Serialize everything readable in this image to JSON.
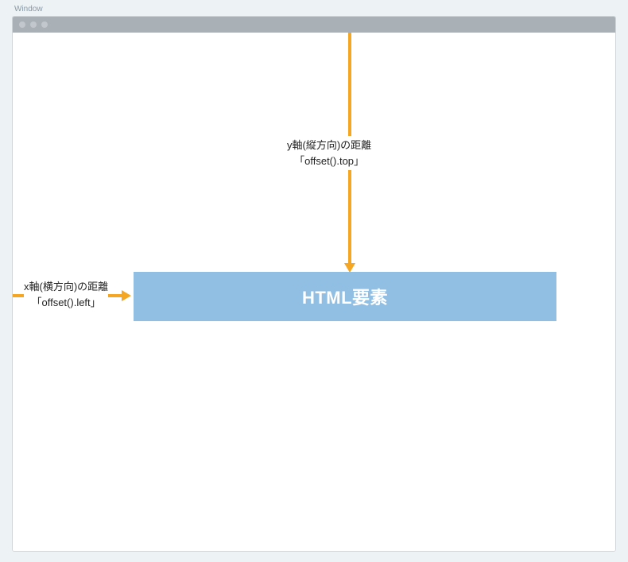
{
  "window_label": "Window",
  "vertical_arrow": {
    "label_line1": "y軸(縦方向)の距離",
    "label_line2": "「offset().top」"
  },
  "horizontal_arrow": {
    "label_line1": "x軸(横方向)の距離",
    "label_line2": "「offset().left」"
  },
  "element_box": {
    "text": "HTML要素"
  },
  "colors": {
    "arrow": "#f5a623",
    "element_box": "#91bfe3",
    "titlebar": "#a9b0b6",
    "background": "#edf2f5"
  }
}
